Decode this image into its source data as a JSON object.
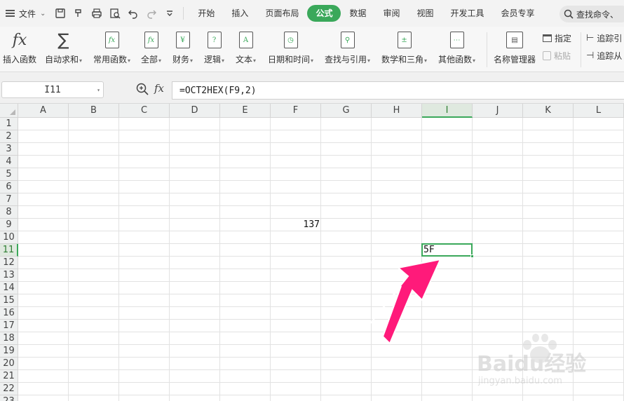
{
  "menubar": {
    "file_label": "文件",
    "tabs": [
      {
        "label": "开始",
        "active": false
      },
      {
        "label": "插入",
        "active": false
      },
      {
        "label": "页面布局",
        "active": false
      },
      {
        "label": "公式",
        "active": true
      },
      {
        "label": "数据",
        "active": false
      },
      {
        "label": "审阅",
        "active": false
      },
      {
        "label": "视图",
        "active": false
      },
      {
        "label": "开发工具",
        "active": false
      },
      {
        "label": "会员专享",
        "active": false
      }
    ],
    "search_placeholder": "查找命令、"
  },
  "ribbon": {
    "insert_function": "插入函数",
    "autosum": "自动求和",
    "common_functions": "常用函数",
    "all": "全部",
    "financial": "财务",
    "logical": "逻辑",
    "text": "文本",
    "datetime": "日期和时间",
    "lookup": "查找与引用",
    "math": "数学和三角",
    "other": "其他函数",
    "name_manager": "名称管理器",
    "define": "指定",
    "paste": "粘贴",
    "trace_precedents": "追踪引",
    "trace_dependents": "追踪从"
  },
  "formula_bar": {
    "name_box": "I11",
    "fx": "fx",
    "formula": "=OCT2HEX(F9,2)"
  },
  "sheet": {
    "columns": [
      "A",
      "B",
      "C",
      "D",
      "E",
      "F",
      "G",
      "H",
      "I",
      "J",
      "K",
      "L"
    ],
    "rows": [
      "1",
      "2",
      "3",
      "4",
      "5",
      "6",
      "7",
      "8",
      "9",
      "10",
      "11",
      "12",
      "13",
      "14",
      "15",
      "16",
      "17",
      "18",
      "19",
      "20",
      "21",
      "22",
      "23"
    ],
    "selected_column": "I",
    "selected_row": "11",
    "cells": {
      "F9": "137",
      "I11": "5F"
    }
  },
  "watermark": {
    "brand": "Baidu经验",
    "url": "jingyan.baidu.com"
  },
  "colors": {
    "accent": "#3aa85a",
    "arrow": "#ff1a7a"
  }
}
